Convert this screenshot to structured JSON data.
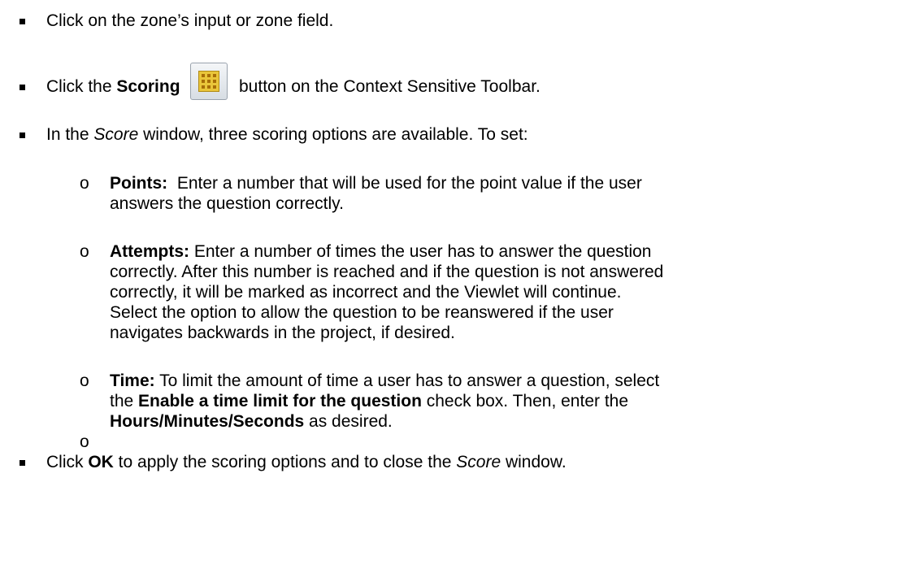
{
  "steps": [
    {
      "text": "Click on the zone’s input or zone field."
    },
    {
      "pre": "Click the ",
      "bold": "Scoring",
      "post": "button on the Context Sensitive Toolbar.",
      "icon": "scoring-icon"
    },
    {
      "pre": "In the ",
      "italic": "Score",
      "post": " window, three scoring options are available. To set:"
    },
    {
      "pre": "Click ",
      "bold": "OK",
      "mid": " to apply the scoring options and to close the ",
      "italic": "Score",
      "post": " window."
    }
  ],
  "options": [
    {
      "bullet": "o",
      "label": "Points:",
      "lines": [
        "  Enter a number that will be used for the point value if the user",
        "answers the question correctly."
      ]
    },
    {
      "bullet": "o",
      "label": "Attempts:",
      "lines": [
        " Enter a number of times the user has to answer the question",
        "correctly. After this number is reached and if the question is not answered",
        "correctly, it will be marked as incorrect and the Viewlet will continue.",
        "Select the option to allow the question to be reanswered if the user",
        "navigates backwards in the project, if desired."
      ]
    },
    {
      "bullet": "o",
      "label": "Time:",
      "line1_pre": " To limit the amount of time a user has to answer a question, select",
      "line2_pre": "the ",
      "line2_bold": "Enable a time limit for the question",
      "line2_post": " check box. Then, enter the",
      "line3_bold": "Hours/Minutes/Seconds",
      "line3_post": " as desired."
    },
    {
      "bullet": "o"
    }
  ]
}
